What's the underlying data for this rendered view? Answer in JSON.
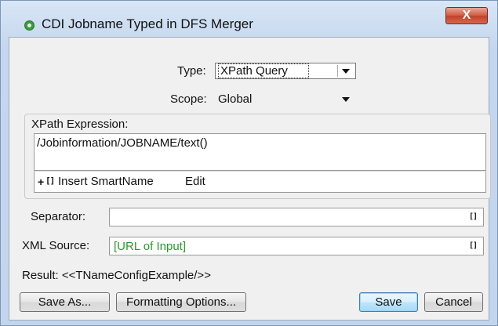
{
  "window": {
    "title": "CDI Jobname Typed in DFS Merger",
    "close_label": "X"
  },
  "type": {
    "label": "Type:",
    "value": "XPath Query"
  },
  "scope": {
    "label": "Scope:",
    "value": "Global"
  },
  "xpath": {
    "label": "XPath Expression:",
    "value": "/Jobinformation/JOBNAME/text()",
    "insert_label": "Insert SmartName",
    "edit_label": "Edit"
  },
  "separator": {
    "label": "Separator:",
    "value": "",
    "icon": "smartname-bracket-icon"
  },
  "xml_source": {
    "label": "XML Source:",
    "value": "[URL of Input]",
    "value_color": "#2a9a2a"
  },
  "result": {
    "text": "Result: <<TNameConfigExample/>>"
  },
  "buttons": {
    "save_as": "Save As...",
    "formatting": "Formatting Options...",
    "save": "Save",
    "cancel": "Cancel"
  }
}
